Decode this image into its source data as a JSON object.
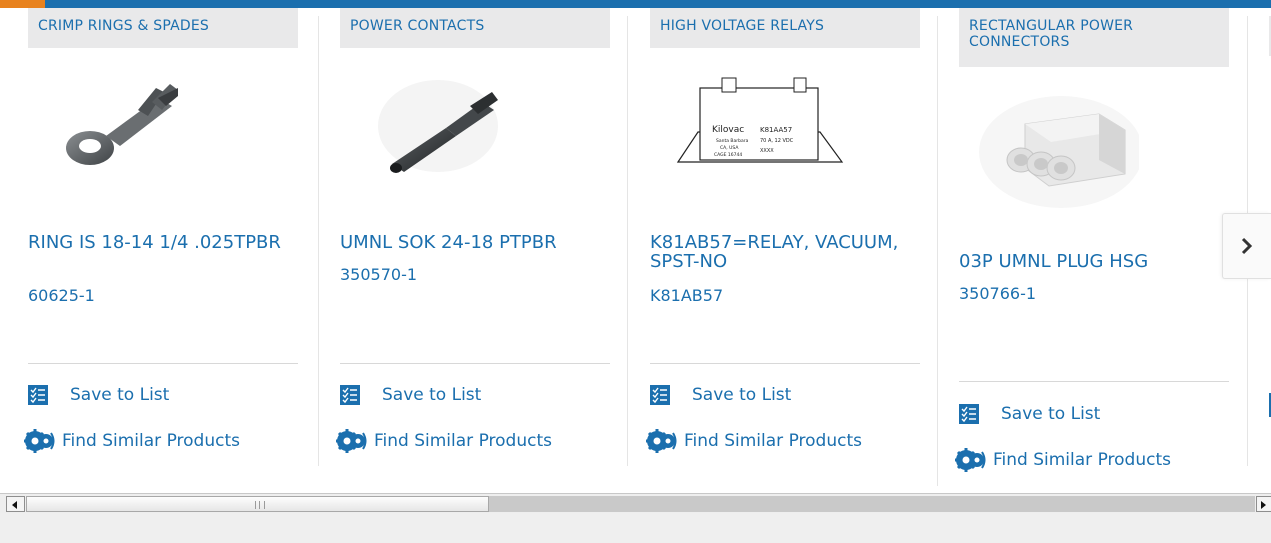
{
  "colors": {
    "link": "#1b6fae",
    "top_bar": "#1b6fae",
    "top_bar_accent": "#e8821e",
    "category_bg": "#e9e9ea"
  },
  "cards": [
    {
      "category": "CRIMP RINGS & SPADES",
      "title": "RING IS 18-14 1/4 .025TPBR",
      "part_number": "60625-1",
      "save_label": "Save to List",
      "similar_label": "Find Similar Products",
      "image": "ring-terminal"
    },
    {
      "category": "POWER CONTACTS",
      "title": "UMNL SOK 24-18 PTPBR",
      "part_number": "350570-1",
      "save_label": "Save to List",
      "similar_label": "Find Similar Products",
      "image": "socket-contact"
    },
    {
      "category": "HIGH VOLTAGE RELAYS",
      "title": "K81AB57=RELAY, VACUUM, SPST-NO",
      "part_number": "K81AB57",
      "save_label": "Save to List",
      "similar_label": "Find Similar Products",
      "image": "vacuum-relay",
      "relay_text": {
        "brand": "Kilovac",
        "model": "K81AA57",
        "rating": "70 A, 12 VDC",
        "origin_1": "Santa Barbara",
        "origin_2": "CA, USA",
        "cage": "CAGE 16744",
        "code": "XXXX"
      }
    },
    {
      "category": "RECTANGULAR POWER CONNECTORS",
      "title": "03P UMNL PLUG HSG",
      "part_number": "350766-1",
      "save_label": "Save to List",
      "similar_label": "Find Similar Products",
      "image": "plug-housing"
    }
  ],
  "next_icon": "chevron-right-icon"
}
